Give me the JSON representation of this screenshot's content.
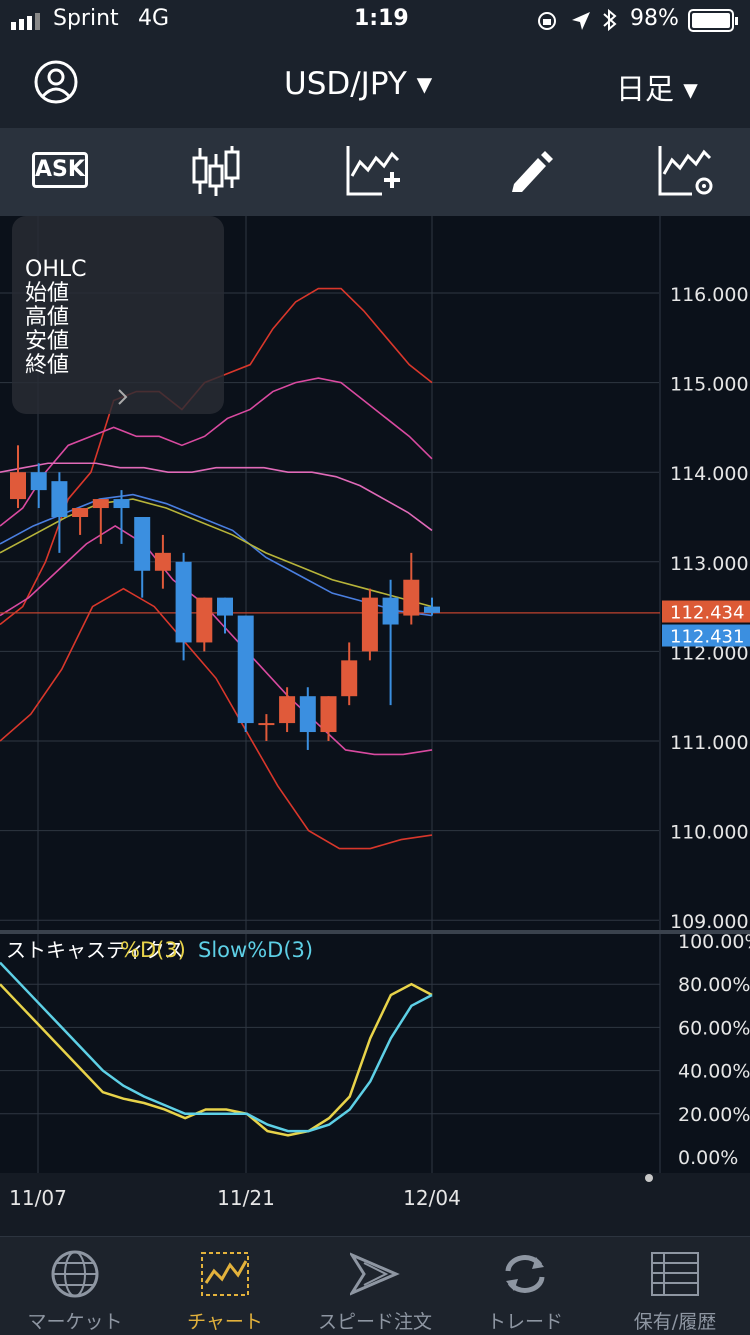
{
  "status": {
    "carrier": "Sprint",
    "network": "4G",
    "time": "1:19",
    "battery": "98%"
  },
  "header": {
    "pair": "USD/JPY ▾",
    "period": "日足 ▾"
  },
  "toolbar": {
    "ask_label": "ASK"
  },
  "ohlc_panel": {
    "title": "OHLC",
    "open": "始値",
    "high": "高値",
    "low": "安値",
    "close": "終値"
  },
  "price_axis": [
    "116.000",
    "115.000",
    "114.000",
    "113.000",
    "112.000",
    "111.000",
    "110.000",
    "109.000"
  ],
  "price_tags": {
    "bid": "112.434",
    "ask": "112.431"
  },
  "stoch": {
    "title": "ストキャスティクス",
    "d": "%D(3)",
    "slow": "Slow%D(3)",
    "axis": [
      "100.00%",
      "80.00%",
      "60.00%",
      "40.00%",
      "20.00%",
      "0.00%"
    ]
  },
  "x_labels": [
    "11/07",
    "11/21",
    "12/04"
  ],
  "tabs": [
    {
      "label": "マーケット",
      "icon": "globe-icon"
    },
    {
      "label": "チャート",
      "icon": "chart-icon"
    },
    {
      "label": "スピード注文",
      "icon": "speed-arrow-icon"
    },
    {
      "label": "トレード",
      "icon": "refresh-icon"
    },
    {
      "label": "保有/履歴",
      "icon": "list-icon"
    }
  ],
  "colors": {
    "up": "#e05a3a",
    "down": "#3b8fe0",
    "accent": "#e3b23c",
    "yellow": "#e8d34a",
    "cyan": "#5ed0e6"
  },
  "chart_data": {
    "type": "candlestick",
    "xlabel": "",
    "ylabel": "",
    "ylim": [
      109.0,
      116.5
    ],
    "candles": [
      {
        "o": 113.7,
        "h": 114.3,
        "l": 113.6,
        "c": 114.0
      },
      {
        "o": 114.0,
        "h": 114.1,
        "l": 113.6,
        "c": 113.8
      },
      {
        "o": 113.9,
        "h": 114.0,
        "l": 113.1,
        "c": 113.5
      },
      {
        "o": 113.5,
        "h": 113.6,
        "l": 113.3,
        "c": 113.6
      },
      {
        "o": 113.6,
        "h": 113.7,
        "l": 113.2,
        "c": 113.7
      },
      {
        "o": 113.7,
        "h": 113.8,
        "l": 113.2,
        "c": 113.6
      },
      {
        "o": 113.5,
        "h": 113.5,
        "l": 112.6,
        "c": 112.9
      },
      {
        "o": 112.9,
        "h": 113.3,
        "l": 112.7,
        "c": 113.1
      },
      {
        "o": 113.0,
        "h": 113.1,
        "l": 111.9,
        "c": 112.1
      },
      {
        "o": 112.1,
        "h": 112.6,
        "l": 112.0,
        "c": 112.6
      },
      {
        "o": 112.6,
        "h": 112.6,
        "l": 112.2,
        "c": 112.4
      },
      {
        "o": 112.4,
        "h": 112.4,
        "l": 111.1,
        "c": 111.2
      },
      {
        "o": 111.2,
        "h": 111.3,
        "l": 111.0,
        "c": 111.2
      },
      {
        "o": 111.2,
        "h": 111.6,
        "l": 111.1,
        "c": 111.5
      },
      {
        "o": 111.5,
        "h": 111.6,
        "l": 110.9,
        "c": 111.1
      },
      {
        "o": 111.1,
        "h": 111.5,
        "l": 111.0,
        "c": 111.5
      },
      {
        "o": 111.5,
        "h": 112.1,
        "l": 111.4,
        "c": 111.9
      },
      {
        "o": 112.0,
        "h": 112.7,
        "l": 111.9,
        "c": 112.6
      },
      {
        "o": 112.6,
        "h": 112.8,
        "l": 111.4,
        "c": 112.3
      },
      {
        "o": 112.4,
        "h": 113.1,
        "l": 112.3,
        "c": 112.8
      },
      {
        "o": 112.5,
        "h": 112.6,
        "l": 112.4,
        "c": 112.43
      }
    ],
    "bands": {
      "upper2": [
        112.3,
        112.5,
        113.0,
        113.7,
        114.0,
        114.8,
        114.9,
        114.9,
        114.7,
        115.0,
        115.1,
        115.2,
        115.6,
        115.9,
        116.05,
        116.05,
        115.8,
        115.5,
        115.2,
        115.0
      ],
      "upper1": [
        113.4,
        113.6,
        114.0,
        114.3,
        114.4,
        114.5,
        114.4,
        114.4,
        114.3,
        114.4,
        114.6,
        114.7,
        114.9,
        115.0,
        115.05,
        115.0,
        114.8,
        114.6,
        114.4,
        114.15
      ],
      "upper_mid": [
        114.0,
        114.05,
        114.1,
        114.1,
        114.1,
        114.05,
        114.05,
        114.0,
        114.0,
        114.05,
        114.05,
        114.05,
        114.0,
        114.0,
        113.95,
        113.85,
        113.7,
        113.55,
        113.35
      ],
      "ma": [
        113.2,
        113.4,
        113.55,
        113.7,
        113.75,
        113.65,
        113.5,
        113.35,
        113.05,
        112.85,
        112.65,
        112.55,
        112.45,
        112.4
      ],
      "lower1": [
        112.4,
        112.6,
        112.9,
        113.2,
        113.4,
        113.2,
        112.8,
        112.55,
        112.2,
        111.85,
        111.5,
        111.2,
        110.9,
        110.85,
        110.85,
        110.9
      ],
      "lower2": [
        111.0,
        111.3,
        111.8,
        112.5,
        112.7,
        112.5,
        112.1,
        111.7,
        111.1,
        110.5,
        110.0,
        109.8,
        109.8,
        109.9,
        109.95
      ]
    },
    "stochastic": {
      "d": [
        80,
        70,
        60,
        50,
        40,
        30,
        27,
        25,
        22,
        18,
        22,
        22,
        20,
        12,
        10,
        12,
        18,
        28,
        55,
        75,
        80,
        75
      ],
      "slow_d": [
        90,
        80,
        70,
        60,
        50,
        40,
        33,
        28,
        24,
        20,
        20,
        20,
        20,
        15,
        12,
        12,
        15,
        22,
        35,
        55,
        70,
        75
      ]
    }
  }
}
